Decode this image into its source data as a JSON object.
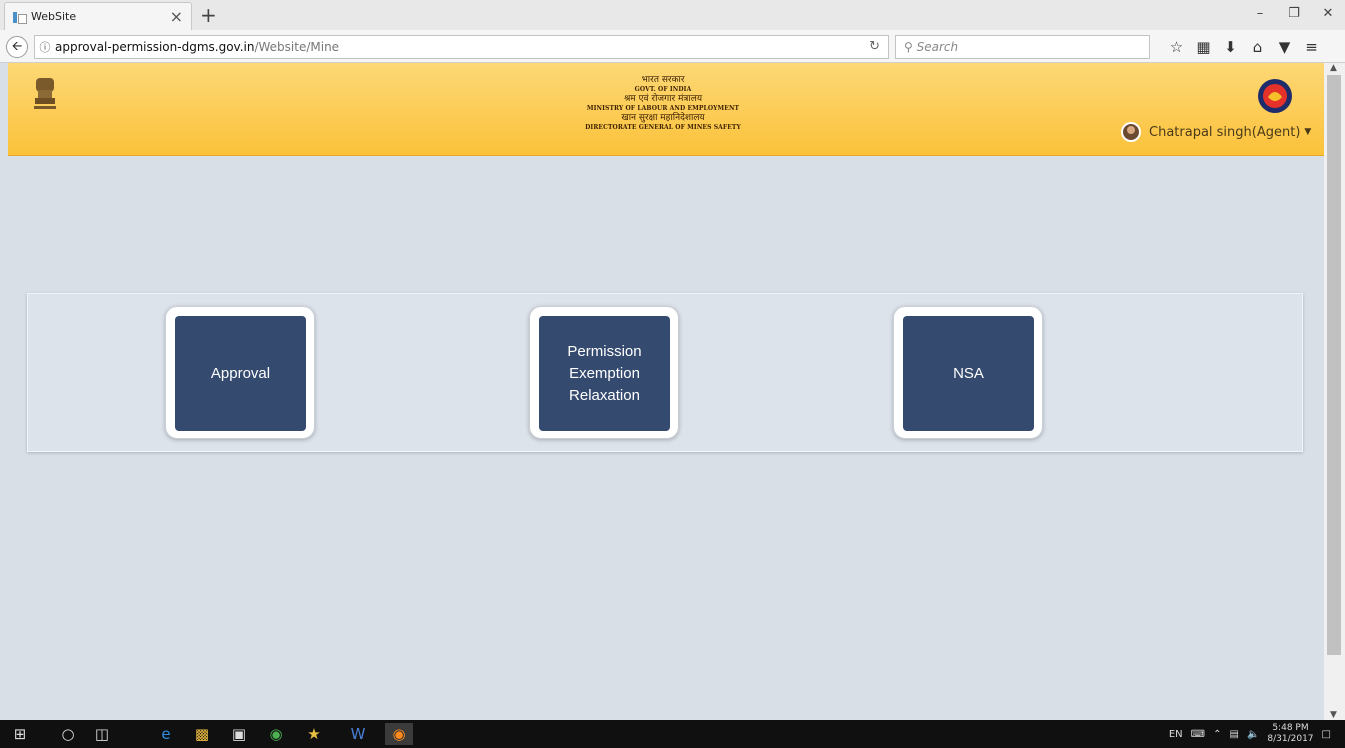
{
  "browser": {
    "tab_title": "WebSite",
    "tab_close": "×",
    "new_tab": "+",
    "url_domain": "approval-permission-dgms.gov.in",
    "url_path": "/Website/Mine",
    "search_placeholder": "Search",
    "icons": [
      "star-icon",
      "reading-list-icon",
      "download-icon",
      "home-icon",
      "pocket-icon",
      "menu-icon"
    ]
  },
  "header": {
    "line1_hindi": "भारत सरकार",
    "line2_eng": "GOVT. OF INDIA",
    "line3_hindi": "श्रम एवं रोजगार मंत्रालय",
    "line4_eng": "MINISTRY OF LABOUR AND EMPLOYMENT",
    "line5_hindi": "खान सुरक्षा महानिदेशालय",
    "line6_eng": "DIRECTORATE GENERAL OF MINES SAFETY",
    "user_name": "Chatrapal singh(Agent)"
  },
  "tiles": {
    "approval": "Approval",
    "permission_line1": "Permission",
    "permission_line2": "Exemption",
    "permission_line3": "Relaxation",
    "nsa": "NSA"
  },
  "taskbar": {
    "language": "EN",
    "time": "5:48 PM",
    "date": "8/31/2017"
  },
  "colors": {
    "header_top": "#fdd876",
    "header_bottom": "#fbc23a",
    "tile": "#344a6e",
    "page_bg": "#d8dfe7"
  }
}
